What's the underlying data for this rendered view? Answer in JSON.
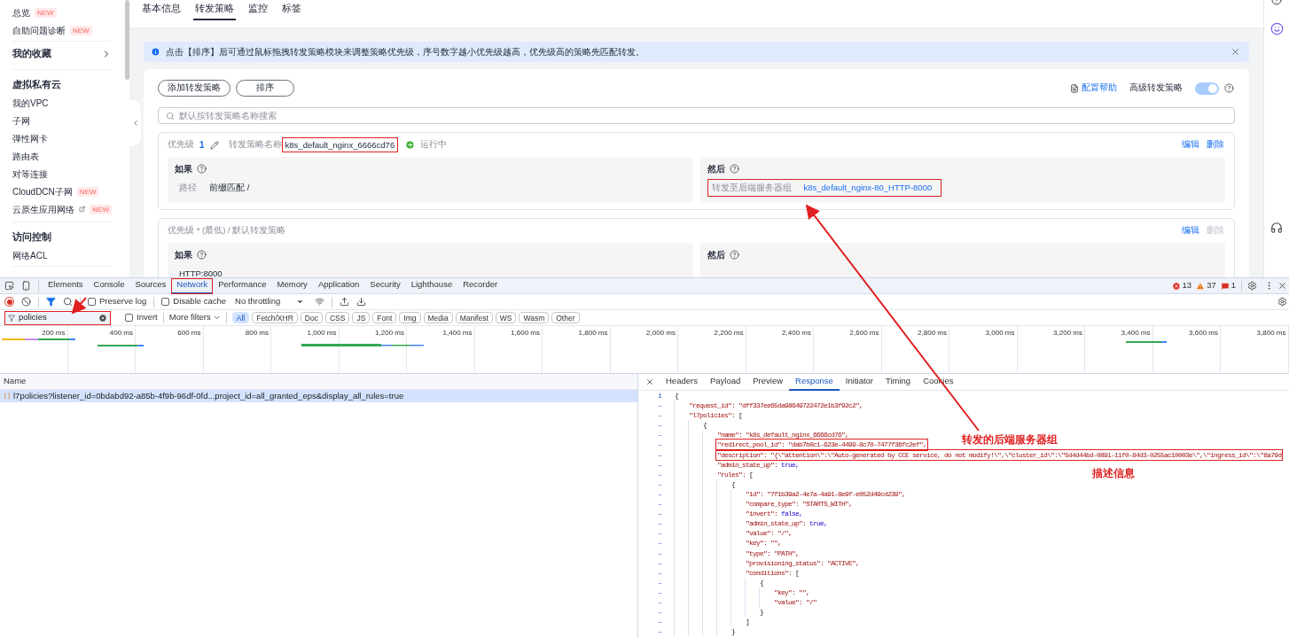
{
  "sidebar": {
    "items": [
      {
        "kind": "item",
        "label": "总览",
        "badge": "NEW",
        "external": false
      },
      {
        "kind": "item",
        "label": "自助问题诊断",
        "badge": "NEW",
        "external": false
      },
      {
        "kind": "favorites",
        "label": "我的收藏"
      },
      {
        "kind": "heading",
        "label": "虚拟私有云"
      },
      {
        "kind": "item",
        "label": "我的VPC",
        "external": false
      },
      {
        "kind": "item",
        "label": "子网",
        "external": false
      },
      {
        "kind": "item",
        "label": "弹性网卡",
        "external": false
      },
      {
        "kind": "item",
        "label": "路由表",
        "external": false
      },
      {
        "kind": "item",
        "label": "对等连接",
        "external": false
      },
      {
        "kind": "item",
        "label": "CloudDCN子网",
        "badge": "NEW",
        "external": false
      },
      {
        "kind": "item",
        "label": "云原生应用网络",
        "badge": "NEW",
        "external": true
      },
      {
        "kind": "heading",
        "label": "访问控制"
      },
      {
        "kind": "item",
        "label": "网络ACL",
        "external": false
      }
    ]
  },
  "tabs": [
    {
      "label": "基本信息",
      "selected": false
    },
    {
      "label": "转发策略",
      "selected": true
    },
    {
      "label": "监控",
      "selected": false
    },
    {
      "label": "标签",
      "selected": false
    }
  ],
  "banner": {
    "text": "点击【排序】后可通过鼠标拖拽转发策略模块来调整策略优先级，序号数字越小优先级越高，优先级高的策略先匹配转发。"
  },
  "toolbar": {
    "buttons": [
      "添加转发策略",
      "排序"
    ],
    "help_link": "配置帮助",
    "advanced_label": "高级转发策略",
    "advanced_on": true
  },
  "search": {
    "placeholder": "默认按转发策略名称搜索"
  },
  "policies": [
    {
      "kind": "numbered",
      "priority_label": "优先级",
      "priority": "1",
      "name_label": "转发策略名称",
      "name": "k8s_default_nginx_6666cd76",
      "name_highlighted": true,
      "status": "运行中",
      "actions": [
        {
          "label": "编辑",
          "disabled": false
        },
        {
          "label": "删除",
          "disabled": false
        }
      ],
      "if": {
        "title": "如果",
        "rows": [
          {
            "kind": "text",
            "label": "路径",
            "value": "前缀匹配 /",
            "highlighted": false
          }
        ]
      },
      "then": {
        "title": "然后",
        "rows": [
          {
            "kind": "link",
            "label": "转发至后端服务器组",
            "value": "k8s_default_nginx-80_HTTP-8000",
            "highlighted": true
          }
        ]
      }
    },
    {
      "kind": "default",
      "header": "优先级 * (最低) / 默认转发策略",
      "actions": [
        {
          "label": "编辑",
          "disabled": false
        },
        {
          "label": "删除",
          "disabled": true
        }
      ],
      "if": {
        "title": "如果",
        "rows": [
          {
            "kind": "text",
            "value": "HTTP:8000",
            "highlighted": false
          }
        ]
      },
      "then": {
        "title": "然后"
      }
    }
  ],
  "devtools": {
    "tabs": [
      {
        "label": "Elements",
        "selected": false,
        "highlighted": false
      },
      {
        "label": "Console",
        "selected": false,
        "highlighted": false
      },
      {
        "label": "Sources",
        "selected": false,
        "highlighted": false
      },
      {
        "label": "Network",
        "selected": true,
        "highlighted": true
      },
      {
        "label": "Performance",
        "selected": false,
        "highlighted": false
      },
      {
        "label": "Memory",
        "selected": false,
        "highlighted": false
      },
      {
        "label": "Application",
        "selected": false,
        "highlighted": false
      },
      {
        "label": "Security",
        "selected": false,
        "highlighted": false
      },
      {
        "label": "Lighthouse",
        "selected": false,
        "highlighted": false
      },
      {
        "label": "Recorder",
        "selected": false,
        "highlighted": false
      }
    ],
    "counts": {
      "errors": "13",
      "warnings": "37",
      "issues": "1"
    },
    "recording": true,
    "preserve_log": {
      "label": "Preserve log",
      "checked": false
    },
    "disable_cache": {
      "label": "Disable cache",
      "checked": false
    },
    "throttling": "No throttling",
    "filter": {
      "value": "policies",
      "highlighted": true
    },
    "invert": {
      "label": "Invert",
      "checked": false
    },
    "more_filters": "More filters",
    "types": [
      {
        "label": "All",
        "selected": true
      },
      {
        "label": "Fetch/XHR",
        "selected": false
      },
      {
        "label": "Doc",
        "selected": false
      },
      {
        "label": "CSS",
        "selected": false
      },
      {
        "label": "JS",
        "selected": false
      },
      {
        "label": "Font",
        "selected": false
      },
      {
        "label": "Img",
        "selected": false
      },
      {
        "label": "Media",
        "selected": false
      },
      {
        "label": "Manifest",
        "selected": false
      },
      {
        "label": "WS",
        "selected": false
      },
      {
        "label": "Wasm",
        "selected": false
      },
      {
        "label": "Other",
        "selected": false
      }
    ],
    "ticks": [
      "200 ms",
      "400 ms",
      "600 ms",
      "800 ms",
      "1,000 ms",
      "1,200 ms",
      "1,400 ms",
      "1,600 ms",
      "1,800 ms",
      "2,000 ms",
      "2,200 ms",
      "2,400 ms",
      "2,600 ms",
      "2,800 ms",
      "3,000 ms",
      "3,200 ms",
      "3,400 ms",
      "3,600 ms",
      "3,800 ms"
    ],
    "requests": {
      "column": "Name",
      "rows": [
        {
          "name": "l7policies?listener_id=0bdabd92-a85b-4f9b-96df-0fd...project_id=all_granted_eps&display_all_rules=true",
          "selected": true
        }
      ]
    },
    "detail_tabs": [
      {
        "label": "Headers",
        "selected": false
      },
      {
        "label": "Payload",
        "selected": false
      },
      {
        "label": "Preview",
        "selected": false
      },
      {
        "label": "Response",
        "selected": true
      },
      {
        "label": "Initiator",
        "selected": false
      },
      {
        "label": "Timing",
        "selected": false
      },
      {
        "label": "Cookies",
        "selected": false
      }
    ],
    "response": [
      {
        "gutter": "1",
        "value": "{",
        "kind": "punct",
        "highlighted": false,
        "children": [
          {
            "gutter": "–",
            "key": "\"request_id\": ",
            "value": "\"dff337ee65da98649722472e1b3f92c2\",",
            "kind": "string",
            "highlighted": false
          },
          {
            "gutter": "–",
            "key": "\"l7policies\": ",
            "value": "[",
            "kind": "punct",
            "highlighted": false,
            "children": [
              {
                "gutter": "–",
                "value": "{",
                "kind": "punct",
                "highlighted": false,
                "children": [
                  {
                    "gutter": "–",
                    "key": "\"name\": ",
                    "value": "\"k8s_default_nginx_6666cd76\",",
                    "kind": "string",
                    "highlighted": false
                  },
                  {
                    "gutter": "–",
                    "key": "\"redirect_pool_id\": ",
                    "value": "\"dab7b0c1-623e-4499-8c70-7477f36fc2ef\",",
                    "kind": "string",
                    "highlighted": true
                  },
                  {
                    "gutter": "–",
                    "key": "\"description\": ",
                    "value": "\"{\\\"attention\\\":\\\"Auto-generated by CCE service, do not modify!\\\",\\\"cluster_id\\\":\\\"5d4d44bd-0891-11f0-84d3-0255ac10003e\\\",\\\"ingress_id\\\":\\\"8a79d",
                    "kind": "string",
                    "highlighted": true
                  },
                  {
                    "gutter": "–",
                    "key": "\"admin_state_up\": ",
                    "value": "true,",
                    "kind": "literal",
                    "highlighted": false
                  },
                  {
                    "gutter": "–",
                    "key": "\"rules\": ",
                    "value": "[",
                    "kind": "punct",
                    "highlighted": false,
                    "children": [
                      {
                        "gutter": "–",
                        "value": "{",
                        "kind": "punct",
                        "highlighted": false,
                        "children": [
                          {
                            "gutter": "–",
                            "key": "\"id\": ",
                            "value": "\"7f1b39a2-4e7a-4a91-8e9f-e052d49cd239\",",
                            "kind": "string",
                            "highlighted": false
                          },
                          {
                            "gutter": "–",
                            "key": "\"compare_type\": ",
                            "value": "\"STARTS_WITH\",",
                            "kind": "string",
                            "highlighted": false
                          },
                          {
                            "gutter": "–",
                            "key": "\"invert\": ",
                            "value": "false,",
                            "kind": "literal",
                            "highlighted": false
                          },
                          {
                            "gutter": "–",
                            "key": "\"admin_state_up\": ",
                            "value": "true,",
                            "kind": "literal",
                            "highlighted": false
                          },
                          {
                            "gutter": "–",
                            "key": "\"value\": ",
                            "value": "\"/\",",
                            "kind": "string",
                            "highlighted": false
                          },
                          {
                            "gutter": "–",
                            "key": "\"key\": ",
                            "value": "\"\",",
                            "kind": "string",
                            "highlighted": false
                          },
                          {
                            "gutter": "–",
                            "key": "\"type\": ",
                            "value": "\"PATH\",",
                            "kind": "string",
                            "highlighted": false
                          },
                          {
                            "gutter": "–",
                            "key": "\"provisioning_status\": ",
                            "value": "\"ACTIVE\",",
                            "kind": "string",
                            "highlighted": false
                          },
                          {
                            "gutter": "–",
                            "key": "\"conditions\": ",
                            "value": "[",
                            "kind": "punct",
                            "highlighted": false,
                            "children": [
                              {
                                "gutter": "–",
                                "value": "{",
                                "kind": "punct",
                                "highlighted": false,
                                "children": [
                                  {
                                    "gutter": "–",
                                    "key": "\"key\": ",
                                    "value": "\"\",",
                                    "kind": "string",
                                    "highlighted": false
                                  },
                                  {
                                    "gutter": "–",
                                    "key": "\"value\": ",
                                    "value": "\"/\"",
                                    "kind": "string",
                                    "highlighted": false
                                  }
                                ]
                              },
                              {
                                "gutter": "–",
                                "value": "}",
                                "kind": "punct",
                                "highlighted": false
                              }
                            ]
                          },
                          {
                            "gutter": "–",
                            "value": "]",
                            "kind": "punct",
                            "highlighted": false
                          }
                        ]
                      },
                      {
                        "gutter": "–",
                        "value": "}",
                        "kind": "punct",
                        "highlighted": false
                      }
                    ]
                  }
                ]
              }
            ]
          }
        ]
      }
    ]
  },
  "annotations": [
    "转发的后端服务器组",
    "描述信息"
  ]
}
